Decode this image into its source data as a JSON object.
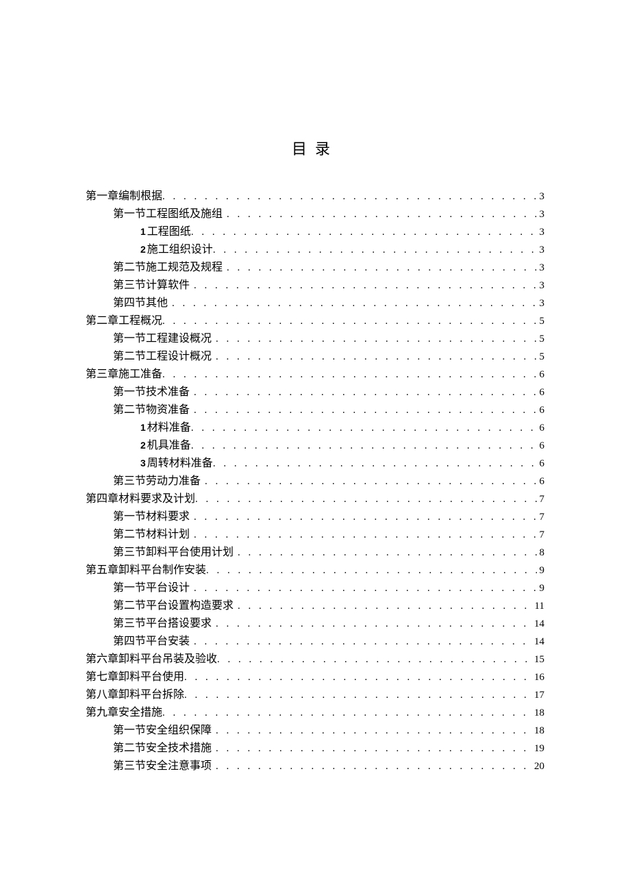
{
  "title": "目录",
  "toc": [
    {
      "level": 0,
      "label": "第一章编制根据",
      "page": "3",
      "pad": false
    },
    {
      "level": 1,
      "label": "第一节工程图纸及施组",
      "page": "3",
      "pad": true
    },
    {
      "level": 2,
      "num": "1",
      "label": "工程图纸",
      "page": "3",
      "pad": false
    },
    {
      "level": 2,
      "num": "2",
      "label": "施工组织设计",
      "page": "3",
      "pad": false
    },
    {
      "level": 1,
      "label": "第二节施工规范及规程",
      "page": "3",
      "pad": true
    },
    {
      "level": 1,
      "label": "第三节计算软件",
      "page": "3",
      "pad": true
    },
    {
      "level": 1,
      "label": "第四节其他",
      "page": "3",
      "pad": true
    },
    {
      "level": 0,
      "label": "第二章工程概况",
      "page": "5",
      "pad": false
    },
    {
      "level": 1,
      "label": "第一节工程建设概况",
      "page": "5",
      "pad": true
    },
    {
      "level": 1,
      "label": "第二节工程设计概况",
      "page": "5",
      "pad": true
    },
    {
      "level": 0,
      "label": "第三章施工准备",
      "page": "6",
      "pad": false
    },
    {
      "level": 1,
      "label": "第一节技术准备",
      "page": "6",
      "pad": true
    },
    {
      "level": 1,
      "label": "第二节物资准备",
      "page": "6",
      "pad": true
    },
    {
      "level": 2,
      "num": "1",
      "label": "材料准备",
      "page": "6",
      "pad": false
    },
    {
      "level": 2,
      "num": "2",
      "label": "机具准备",
      "page": "6",
      "pad": false
    },
    {
      "level": 2,
      "num": "3",
      "label": "周转材料准备",
      "page": "6",
      "pad": false
    },
    {
      "level": 1,
      "label": "第三节劳动力准备",
      "page": "6",
      "pad": true
    },
    {
      "level": 0,
      "label": "第四章材料要求及计划",
      "page": "7",
      "pad": false
    },
    {
      "level": 1,
      "label": "第一节材料要求",
      "page": "7",
      "pad": true
    },
    {
      "level": 1,
      "label": "第二节材料计划",
      "page": "7",
      "pad": true
    },
    {
      "level": 1,
      "label": "第三节卸料平台使用计划",
      "page": "8",
      "pad": true
    },
    {
      "level": 0,
      "label": "第五章卸料平台制作安装",
      "page": "9",
      "pad": false
    },
    {
      "level": 1,
      "label": "第一节平台设计",
      "page": "9",
      "pad": true
    },
    {
      "level": 1,
      "label": "第二节平台设置构造要求",
      "page": "11",
      "pad": true
    },
    {
      "level": 1,
      "label": "第三节平台搭设要求",
      "page": "14",
      "pad": true
    },
    {
      "level": 1,
      "label": "第四节平台安装",
      "page": "14",
      "pad": true
    },
    {
      "level": 0,
      "label": "第六章卸料平台吊装及验收",
      "page": "15",
      "pad": false
    },
    {
      "level": 0,
      "label": "第七章卸料平台使用",
      "page": "16",
      "pad": false
    },
    {
      "level": 0,
      "label": "第八章卸料平台拆除",
      "page": "17",
      "pad": false
    },
    {
      "level": 0,
      "label": "第九章安全措施",
      "page": "18",
      "pad": false
    },
    {
      "level": 1,
      "label": "第一节安全组织保障",
      "page": "18",
      "pad": true
    },
    {
      "level": 1,
      "label": "第二节安全技术措施",
      "page": "19",
      "pad": true
    },
    {
      "level": 1,
      "label": "第三节安全注意事项",
      "page": "20",
      "pad": true
    }
  ]
}
